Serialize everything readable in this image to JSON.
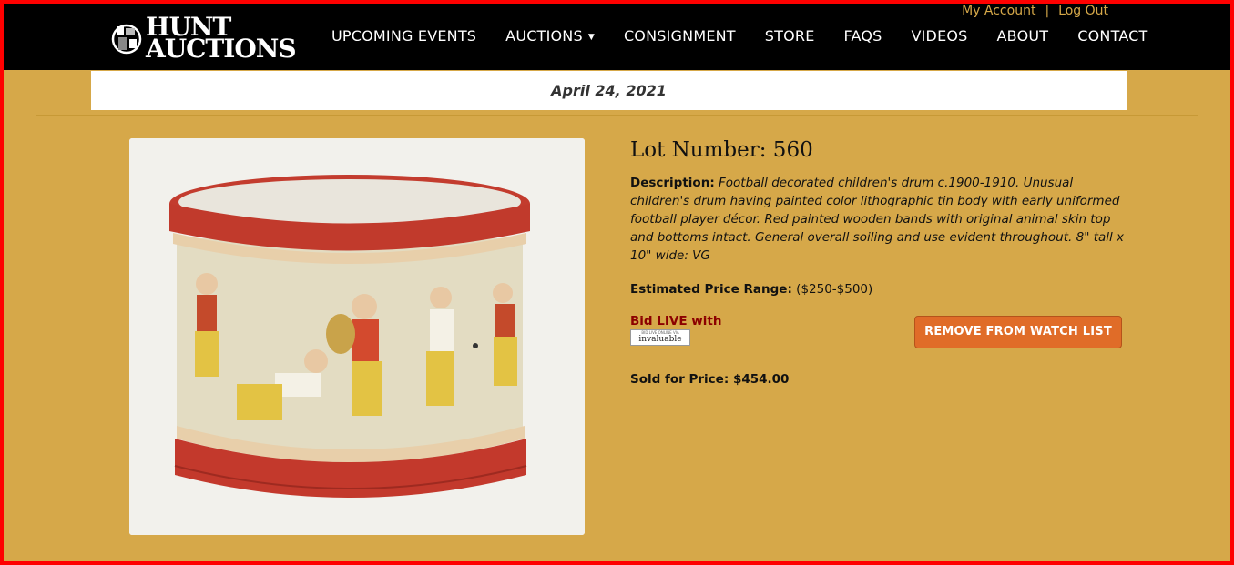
{
  "brand": {
    "line1": "HUNT",
    "line2": "AUCTIONS"
  },
  "account": {
    "my_account": "My Account",
    "separator": "|",
    "log_out": "Log Out"
  },
  "nav": {
    "items": [
      {
        "label": "UPCOMING EVENTS"
      },
      {
        "label": "AUCTIONS"
      },
      {
        "label": "CONSIGNMENT"
      },
      {
        "label": "STORE"
      },
      {
        "label": "FAQS"
      },
      {
        "label": "VIDEOS"
      },
      {
        "label": "ABOUT"
      },
      {
        "label": "CONTACT"
      }
    ]
  },
  "auction_date": "April 24, 2021",
  "lot": {
    "title": "Lot Number: 560",
    "description_label": "Description:",
    "description": "Football decorated children's drum c.1900-1910. Unusual children's drum having painted color lithographic tin body with early uniformed football player décor. Red painted wooden bands with original animal skin top and bottoms intact. General overall soiling and use evident throughout. 8\" tall x 10\" wide: VG",
    "estimate_label": "Estimated Price Range:",
    "estimate_value": "($250-$500)",
    "bid_live": "Bid LIVE with",
    "invaluable_top": "BID LIVE ONLINE VIA",
    "invaluable": "invaluable",
    "sold_label": "Sold for Price:",
    "sold_value": "$454.00"
  },
  "watch_button": "REMOVE FROM WATCH LIST",
  "colors": {
    "background": "#d6a849",
    "navbar": "#000000",
    "accent": "#e06c28",
    "border": "#ff0000"
  }
}
